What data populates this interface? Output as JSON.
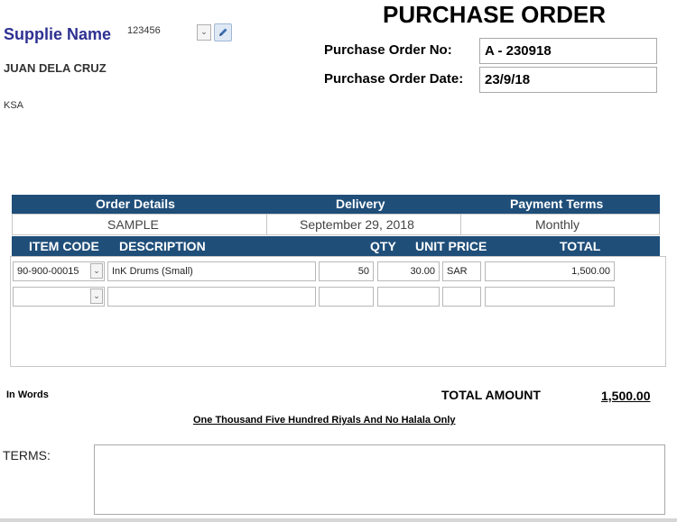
{
  "supplier": {
    "label": "Supplie Name",
    "code": "123456",
    "name": "JUAN DELA CRUZ",
    "address": "KSA"
  },
  "title": "PURCHASE ORDER",
  "po": {
    "number_label": "Purchase Order No:",
    "number_value": "A - 230918",
    "date_label": "Purchase Order Date:",
    "date_value": "23/9/18"
  },
  "summary": {
    "headers": [
      "Order Details",
      "Delivery",
      "Payment Terms"
    ],
    "values": [
      "SAMPLE",
      "September 29, 2018",
      "Monthly"
    ]
  },
  "items": {
    "headers": {
      "item_code": "ITEM CODE",
      "description": "DESCRIPTION",
      "qty": "QTY",
      "unit_price": "UNIT PRICE",
      "total": "TOTAL"
    },
    "rows": [
      {
        "item_code": "90-900-00015",
        "description": "InK Drums (Small)",
        "qty": "50",
        "unit_price": "30.00",
        "currency": "SAR",
        "total": "1,500.00"
      },
      {
        "item_code": "",
        "description": "",
        "qty": "",
        "unit_price": "",
        "currency": "",
        "total": ""
      }
    ]
  },
  "footer": {
    "in_words_label": "In Words",
    "total_amount_label": "TOTAL AMOUNT",
    "total_amount_value": "1,500.00",
    "amount_words": "One Thousand Five Hundred Riyals And No Halala Only",
    "terms_label": "TERMS:",
    "terms_value": ""
  },
  "colors": {
    "header_bar": "#1f4e79",
    "supplier_label": "#2e3192"
  },
  "icons": {
    "combo": "chevron-down-icon",
    "edit": "pencil-icon"
  }
}
